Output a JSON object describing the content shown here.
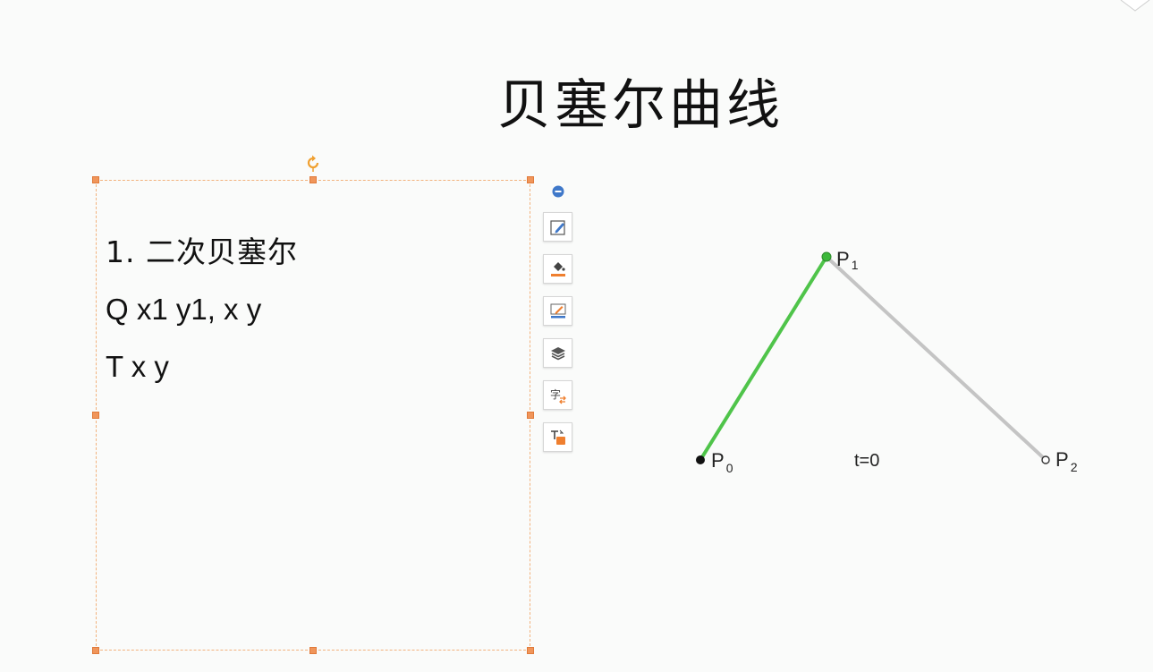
{
  "slide": {
    "title": "贝塞尔曲线",
    "textbox": {
      "lines": [
        "1. 二次贝塞尔",
        "Q x1 y1, x y",
        "T x y"
      ]
    },
    "toolbar": {
      "buttons": [
        {
          "name": "shape-style-button",
          "icon": "pencil-square-icon"
        },
        {
          "name": "shape-fill-button",
          "icon": "paint-bucket-icon"
        },
        {
          "name": "shape-outline-button",
          "icon": "pen-line-icon"
        },
        {
          "name": "arrange-layers-button",
          "icon": "layers-icon"
        },
        {
          "name": "text-style-button",
          "icon": "character-swap-icon"
        },
        {
          "name": "text-fill-button",
          "icon": "text-color-icon"
        }
      ]
    },
    "diagram": {
      "points": [
        {
          "name": "P",
          "sub": "0",
          "style": "filled-black"
        },
        {
          "name": "P",
          "sub": "1",
          "style": "filled-green"
        },
        {
          "name": "P",
          "sub": "2",
          "style": "hollow"
        }
      ],
      "t_label": "t=0",
      "colors": {
        "active_segment": "#4fc44a",
        "inactive_segment": "#c4c4c4",
        "handles": "#f0955a"
      }
    }
  }
}
